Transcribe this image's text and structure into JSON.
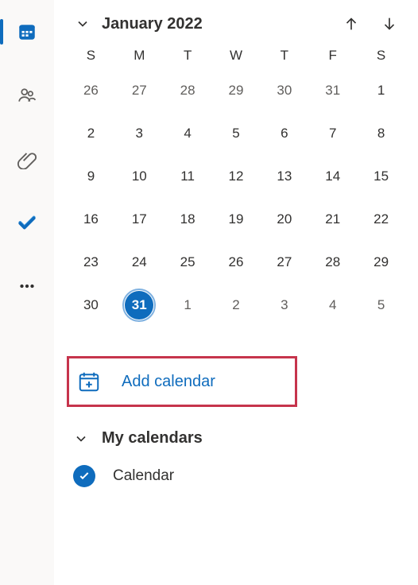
{
  "month_label": "January 2022",
  "dow": [
    "S",
    "M",
    "T",
    "W",
    "T",
    "F",
    "S"
  ],
  "weeks": [
    [
      {
        "n": 26,
        "in": false
      },
      {
        "n": 27,
        "in": false
      },
      {
        "n": 28,
        "in": false
      },
      {
        "n": 29,
        "in": false
      },
      {
        "n": 30,
        "in": false
      },
      {
        "n": 31,
        "in": false
      },
      {
        "n": 1,
        "in": true
      }
    ],
    [
      {
        "n": 2,
        "in": true
      },
      {
        "n": 3,
        "in": true
      },
      {
        "n": 4,
        "in": true
      },
      {
        "n": 5,
        "in": true
      },
      {
        "n": 6,
        "in": true
      },
      {
        "n": 7,
        "in": true
      },
      {
        "n": 8,
        "in": true
      }
    ],
    [
      {
        "n": 9,
        "in": true
      },
      {
        "n": 10,
        "in": true
      },
      {
        "n": 11,
        "in": true
      },
      {
        "n": 12,
        "in": true
      },
      {
        "n": 13,
        "in": true
      },
      {
        "n": 14,
        "in": true
      },
      {
        "n": 15,
        "in": true
      }
    ],
    [
      {
        "n": 16,
        "in": true
      },
      {
        "n": 17,
        "in": true
      },
      {
        "n": 18,
        "in": true
      },
      {
        "n": 19,
        "in": true
      },
      {
        "n": 20,
        "in": true
      },
      {
        "n": 21,
        "in": true
      },
      {
        "n": 22,
        "in": true
      }
    ],
    [
      {
        "n": 23,
        "in": true
      },
      {
        "n": 24,
        "in": true
      },
      {
        "n": 25,
        "in": true
      },
      {
        "n": 26,
        "in": true
      },
      {
        "n": 27,
        "in": true
      },
      {
        "n": 28,
        "in": true
      },
      {
        "n": 29,
        "in": true
      }
    ],
    [
      {
        "n": 30,
        "in": true
      },
      {
        "n": 31,
        "in": true,
        "today": true
      },
      {
        "n": 1,
        "in": false
      },
      {
        "n": 2,
        "in": false
      },
      {
        "n": 3,
        "in": false
      },
      {
        "n": 4,
        "in": false
      },
      {
        "n": 5,
        "in": false
      }
    ]
  ],
  "add_calendar_label": "Add calendar",
  "section_label": "My calendars",
  "calendar_entry_label": "Calendar"
}
